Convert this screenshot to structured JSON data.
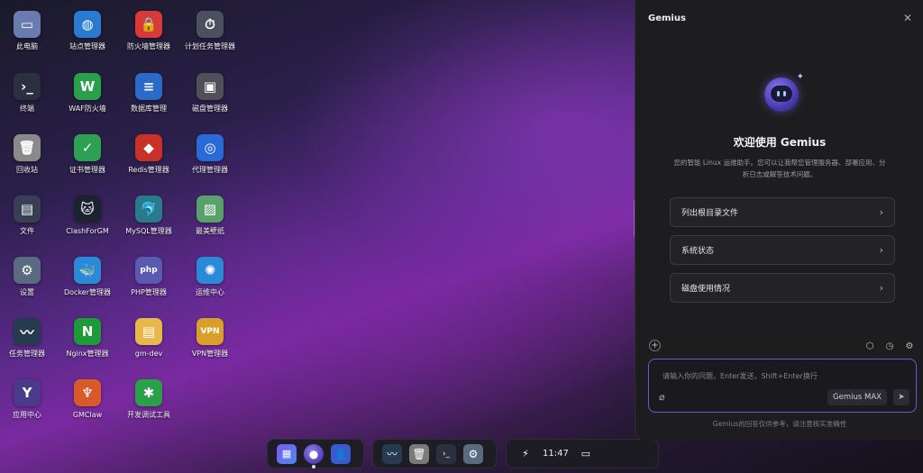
{
  "desktop": {
    "icons": [
      {
        "label": "此电脑",
        "icon": "computer-icon",
        "color": "#6a7bb0",
        "glyph": "▭"
      },
      {
        "label": "终端",
        "icon": "terminal-icon",
        "color": "#2a3040",
        "glyph": "›_"
      },
      {
        "label": "回收站",
        "icon": "trash-icon",
        "color": "#8a8a8a",
        "glyph": "🗑"
      },
      {
        "label": "文件",
        "icon": "folder-icon",
        "color": "#3a3e54",
        "glyph": "▤"
      },
      {
        "label": "设置",
        "icon": "gear-icon",
        "color": "#5a6a80",
        "glyph": "⚙"
      },
      {
        "label": "任务管理器",
        "icon": "task-manager-icon",
        "color": "#263a50",
        "glyph": "〰"
      },
      {
        "label": "应用中心",
        "icon": "app-center-icon",
        "color": "#4a3a8a",
        "glyph": "Y"
      },
      {
        "label": "站点管理器",
        "icon": "globe-icon",
        "color": "#2a7ad0",
        "glyph": "◍"
      },
      {
        "label": "WAF防火墙",
        "icon": "waf-icon",
        "color": "#2aa04a",
        "glyph": "W"
      },
      {
        "label": "证书管理器",
        "icon": "certificate-icon",
        "color": "#2ea054",
        "glyph": "✓"
      },
      {
        "label": "ClashForGM",
        "icon": "cat-icon",
        "color": "#1c2230",
        "glyph": "🐱"
      },
      {
        "label": "Docker管理器",
        "icon": "docker-icon",
        "color": "#2a8ad8",
        "glyph": "🐳"
      },
      {
        "label": "Nginx管理器",
        "icon": "nginx-icon",
        "color": "#1e9a3a",
        "glyph": "N"
      },
      {
        "label": "GMClaw",
        "icon": "claw-icon",
        "color": "#d85a2a",
        "glyph": "♆"
      },
      {
        "label": "防火墙管理器",
        "icon": "firewall-icon",
        "color": "#d83a3a",
        "glyph": "🔒"
      },
      {
        "label": "数据库管理",
        "icon": "database-icon",
        "color": "#2a6ac8",
        "glyph": "≡"
      },
      {
        "label": "Redis管理器",
        "icon": "redis-icon",
        "color": "#c8302a",
        "glyph": "◆"
      },
      {
        "label": "MySQL管理器",
        "icon": "mysql-icon",
        "color": "#2a7a8a",
        "glyph": "🐬"
      },
      {
        "label": "PHP管理器",
        "icon": "php-icon",
        "color": "#5a5ab0",
        "glyph": "php"
      },
      {
        "label": "gm-dev",
        "icon": "folder-shortcut-icon",
        "color": "#e8b84a",
        "glyph": "▤"
      },
      {
        "label": "开发调试工具",
        "icon": "bug-icon",
        "color": "#2aa04a",
        "glyph": "✱"
      },
      {
        "label": "计划任务管理器",
        "icon": "schedule-icon",
        "color": "#4a5060",
        "glyph": "⏱"
      },
      {
        "label": "磁盘管理器",
        "icon": "disk-icon",
        "color": "#505058",
        "glyph": "▣"
      },
      {
        "label": "代理管理器",
        "icon": "proxy-icon",
        "color": "#2a6ad8",
        "glyph": "◎"
      },
      {
        "label": "最美壁纸",
        "icon": "wallpaper-icon",
        "color": "#5aa06a",
        "glyph": "▨"
      },
      {
        "label": "运维中心",
        "icon": "ops-center-icon",
        "color": "#2a8ad8",
        "glyph": "✺"
      },
      {
        "label": "VPN管理器",
        "icon": "vpn-icon",
        "color": "#d8a02a",
        "glyph": "VPN"
      }
    ]
  },
  "taskbar": {
    "time": "11:47"
  },
  "gemius": {
    "title": "Gemius",
    "welcome": "欢迎使用 Gemius",
    "description": "您的智能 Linux 运维助手。您可以让我帮您管理服务器、部署应用、分析日志或解答技术问题。",
    "suggestions": [
      "列出根目录文件",
      "系统状态",
      "磁盘使用情况"
    ],
    "input_placeholder": "请输入你的问题，Enter发送，Shift+Enter换行",
    "model": "Gemius MAX",
    "footer_note": "Gemius的回答仅供参考，请注意核实准确性"
  }
}
